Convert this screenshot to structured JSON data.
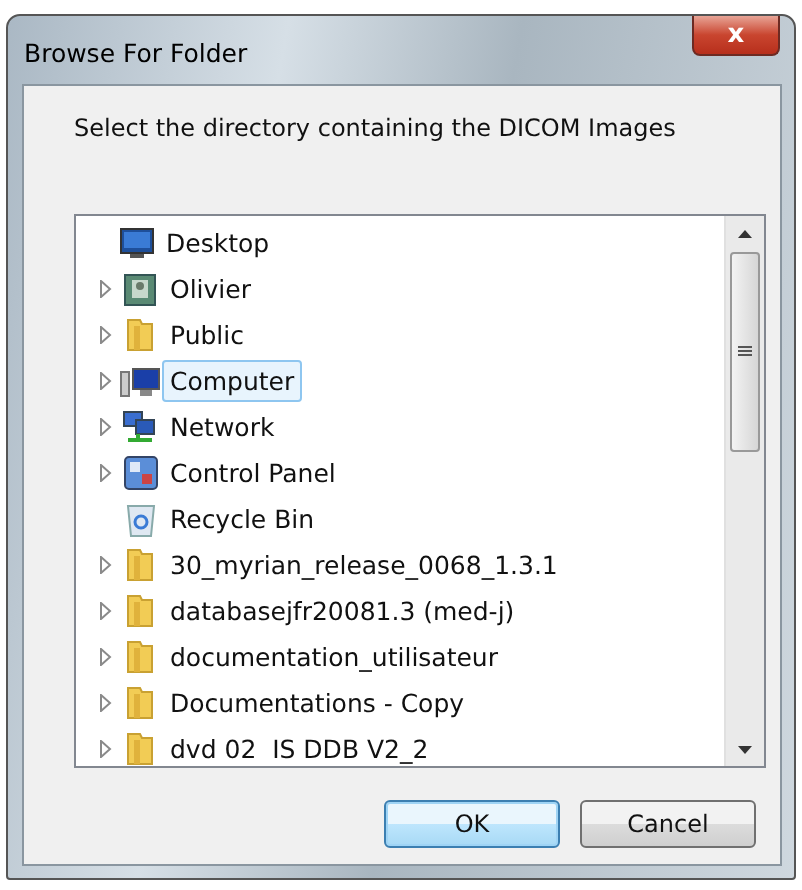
{
  "window": {
    "title": "Browse For Folder",
    "close": "x"
  },
  "prompt": "Select the directory containing the DICOM Images",
  "tree": {
    "items": [
      {
        "label": "Desktop",
        "kind": "desktop",
        "expandable": false,
        "selected": false,
        "children": [
          {
            "label": "Olivier",
            "kind": "user",
            "expandable": true,
            "selected": false
          },
          {
            "label": "Public",
            "kind": "folder",
            "expandable": true,
            "selected": false
          },
          {
            "label": "Computer",
            "kind": "computer",
            "expandable": true,
            "selected": true
          },
          {
            "label": "Network",
            "kind": "network",
            "expandable": true,
            "selected": false
          },
          {
            "label": "Control Panel",
            "kind": "control-panel",
            "expandable": true,
            "selected": false
          },
          {
            "label": "Recycle Bin",
            "kind": "recycle-bin",
            "expandable": false,
            "selected": false
          },
          {
            "label": "30_myrian_release_0068_1.3.1",
            "kind": "folder",
            "expandable": true,
            "selected": false
          },
          {
            "label": "databasejfr20081.3 (med-j)",
            "kind": "folder",
            "expandable": true,
            "selected": false
          },
          {
            "label": "documentation_utilisateur",
            "kind": "folder",
            "expandable": true,
            "selected": false
          },
          {
            "label": "Documentations - Copy",
            "kind": "folder",
            "expandable": true,
            "selected": false
          },
          {
            "label": "dvd 02  IS DDB V2_2",
            "kind": "folder",
            "expandable": true,
            "selected": false
          }
        ]
      }
    ]
  },
  "buttons": [
    {
      "label": "OK",
      "default": true
    },
    {
      "label": "Cancel",
      "default": false
    }
  ]
}
